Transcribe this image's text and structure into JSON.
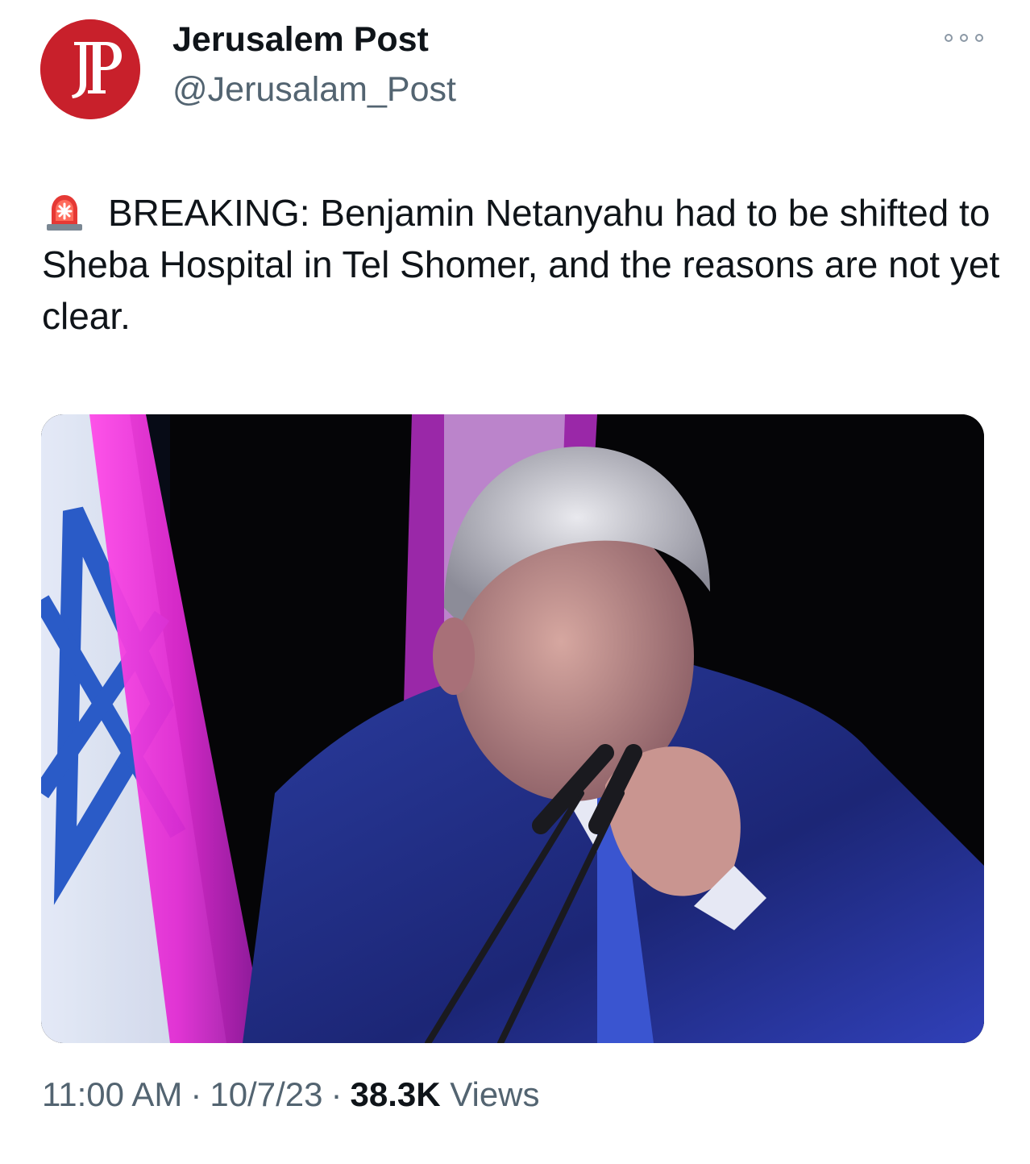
{
  "tweet": {
    "author": {
      "display_name": "Jerusalem Post",
      "handle": "@Jerusalam_Post",
      "avatar_text": "JP",
      "avatar_color": "#c8202b"
    },
    "more_icon": "more-horizontal-icon",
    "text": {
      "emoji_icon": "police-car-light-icon",
      "body": "BREAKING: Benjamin Netanyahu had to be shifted to Sheba Hospital in Tel Shomer, and the reasons are not yet clear."
    },
    "meta": {
      "time": "11:00 AM",
      "separator": "·",
      "date": "10/7/23",
      "views_count": "38.3K",
      "views_label": "Views"
    }
  },
  "colors": {
    "primary_text": "#0f1419",
    "secondary_text": "#536471"
  }
}
